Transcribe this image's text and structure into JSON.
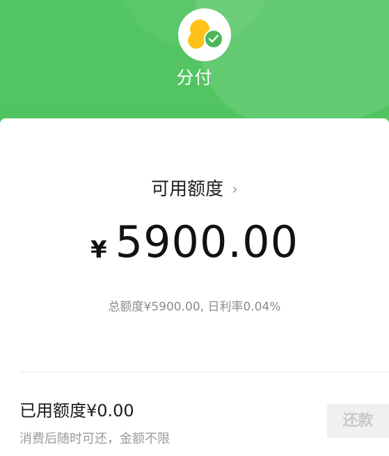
{
  "header": {
    "title": "分付",
    "logo_icon": "wechat-pay-fenfu-logo-icon",
    "colors": {
      "background": "#4cc35c",
      "logo_yellow": "#ffc21a",
      "logo_green": "#48b85a"
    }
  },
  "card": {
    "available_label": "可用额度",
    "available_arrow": "›",
    "currency_symbol": "¥",
    "available_amount": "5900.00",
    "summary": "总额度¥5900.00, 日利率0.04%",
    "used_label": "已用额度¥0.00",
    "used_description": "消费后随时可还，金额不限",
    "repay_button": "还款"
  }
}
